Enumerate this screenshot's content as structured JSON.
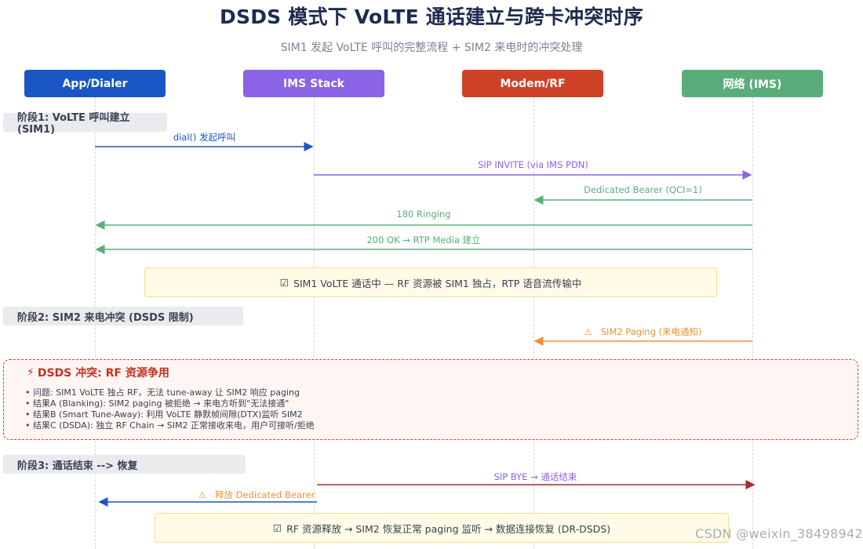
{
  "header": {
    "title": "DSDS 模式下 VoLTE 通话建立与跨卡冲突时序",
    "subtitle": "SIM1 发起 VoLTE 呼叫的完整流程 + SIM2 来电时的冲突处理"
  },
  "colors": {
    "app": "#1a55c4",
    "ims": "#8a63e6",
    "modem": "#cf4127",
    "network": "#5aad7a",
    "warn": "#ee9133",
    "bye": "#b3262a"
  },
  "actors": [
    {
      "label": "App/Dialer"
    },
    {
      "label": "IMS Stack"
    },
    {
      "label": "Modem/RF"
    },
    {
      "label": "网络 (IMS)"
    }
  ],
  "phases": {
    "p1": "阶段1: VoLTE 呼叫建立 (SIM1)",
    "p2": "阶段2: SIM2 来电冲突 (DSDS 限制)",
    "p3": "阶段3: 通话结束 --> 恢复"
  },
  "messages": {
    "dial": "dial() 发起呼叫",
    "invite": "SIP INVITE (via IMS PDN)",
    "bearer": "Dedicated Bearer (QCI=1)",
    "ringing": "180 Ringing",
    "ok": "200 OK → RTP Media 建立",
    "paging": "SIM2 Paging (来电通知)",
    "bye": "SIP BYE → 通话结束",
    "release": "释放 Dedicated Bearer"
  },
  "notes": {
    "in_call": "SIM1 VoLTE 通话中 — RF 资源被 SIM1 独占，RTP 语音流传输中",
    "recovery": "RF 资源释放 → SIM2 恢复正常 paging 监听 → 数据连接恢复 (DR-DSDS)"
  },
  "conflict": {
    "title": "DSDS 冲突: RF 资源争用",
    "bullets": [
      "问题: SIM1 VoLTE 独占 RF，无法 tune-away 让 SIM2 响应 paging",
      "结果A (Blanking): SIM2 paging 被拒绝 → 来电方听到\"无法接通\"",
      "结果B (Smart Tune-Away): 利用 VoLTE 静默帧间隙(DTX)监听 SIM2",
      "结果C (DSDA): 独立 RF Chain → SIM2 正常接收来电，用户可接听/拒绝"
    ]
  },
  "watermark": "CSDN @weixin_38498942"
}
